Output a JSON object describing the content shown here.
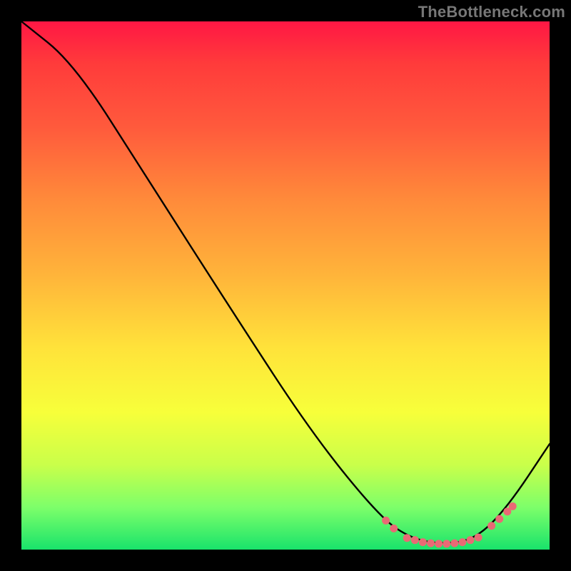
{
  "watermark": "TheBottleneck.com",
  "chart_data": {
    "type": "line",
    "title": "",
    "xlabel": "",
    "ylabel": "",
    "ylim": [
      0,
      100
    ],
    "xlim": [
      0,
      100
    ],
    "series": [
      {
        "name": "curve",
        "points": [
          {
            "x": 0,
            "y": 100
          },
          {
            "x": 10,
            "y": 92
          },
          {
            "x": 24,
            "y": 70
          },
          {
            "x": 40,
            "y": 45
          },
          {
            "x": 55,
            "y": 22
          },
          {
            "x": 68,
            "y": 6
          },
          {
            "x": 74,
            "y": 2
          },
          {
            "x": 80,
            "y": 1
          },
          {
            "x": 86,
            "y": 2
          },
          {
            "x": 92,
            "y": 8
          },
          {
            "x": 100,
            "y": 20
          }
        ]
      }
    ],
    "markers": {
      "name": "dots",
      "color": "#e96a75",
      "points": [
        {
          "x": 69,
          "y": 5.5
        },
        {
          "x": 70.5,
          "y": 4.0
        },
        {
          "x": 73,
          "y": 2.2
        },
        {
          "x": 74.5,
          "y": 1.8
        },
        {
          "x": 76,
          "y": 1.4
        },
        {
          "x": 77.5,
          "y": 1.2
        },
        {
          "x": 79,
          "y": 1.1
        },
        {
          "x": 80.5,
          "y": 1.1
        },
        {
          "x": 82,
          "y": 1.2
        },
        {
          "x": 83.5,
          "y": 1.4
        },
        {
          "x": 85,
          "y": 1.8
        },
        {
          "x": 86.5,
          "y": 2.3
        },
        {
          "x": 89,
          "y": 4.5
        },
        {
          "x": 90.5,
          "y": 5.8
        },
        {
          "x": 92,
          "y": 7.2
        },
        {
          "x": 93,
          "y": 8.2
        }
      ]
    }
  }
}
